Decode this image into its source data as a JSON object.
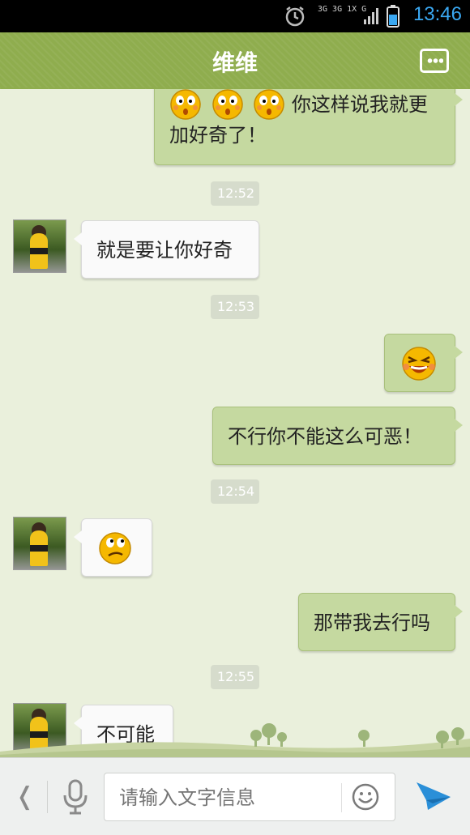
{
  "status_bar": {
    "network_text": "3G 3G 1X G",
    "time": "13:46"
  },
  "header": {
    "title": "维维",
    "menu_icon": "more-icon"
  },
  "messages": [
    {
      "kind": "out",
      "text_line1": "你这样说我就更",
      "text_line2": "加好奇了！",
      "emojis": [
        "surprised-face-icon",
        "surprised-face-icon",
        "surprised-face-icon"
      ]
    },
    {
      "kind": "time",
      "text": "12:52"
    },
    {
      "kind": "in",
      "text": "就是要让你好奇"
    },
    {
      "kind": "time",
      "text": "12:53"
    },
    {
      "kind": "out",
      "emoji": "laughing-face-icon"
    },
    {
      "kind": "out",
      "text": "不行你不能这么可恶！"
    },
    {
      "kind": "time",
      "text": "12:54"
    },
    {
      "kind": "in",
      "emoji": "confused-face-icon"
    },
    {
      "kind": "out",
      "text": "那带我去行吗"
    },
    {
      "kind": "time",
      "text": "12:55"
    },
    {
      "kind": "in",
      "text": "不可能"
    }
  ],
  "input_bar": {
    "back_label": "❬",
    "placeholder": "请输入文字信息"
  },
  "colors": {
    "header_green": "#8fad4e",
    "out_bubble": "#c5d9a0",
    "chat_background": "#eaf0dc",
    "time_accent": "#3aa8f2"
  }
}
